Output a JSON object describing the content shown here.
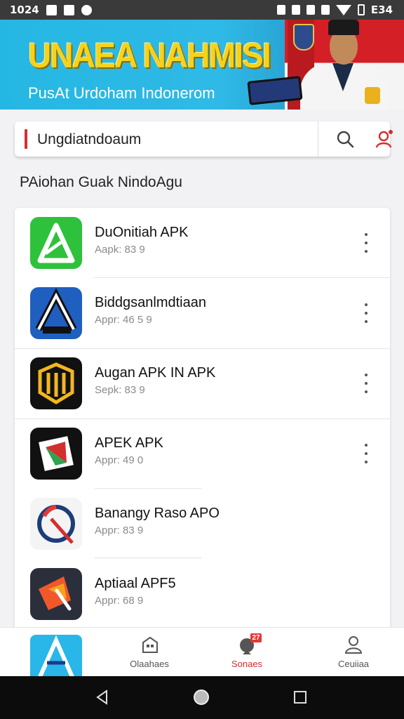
{
  "status_bar": {
    "time": "1024",
    "battery": "E34"
  },
  "banner": {
    "title": "UNAEA NAHMISI",
    "subtitle": "PusAt Urdoham Indonerom"
  },
  "search": {
    "value": "Ungdiatndoaum",
    "placeholder": ""
  },
  "section_title": "PAiohan Guak NindoAgu",
  "apps": [
    {
      "name": "DuOnitiah APK",
      "size": "Aapk: 83 9"
    },
    {
      "name": "Biddgsanlmdtiaan",
      "size": "Appr: 46 5 9"
    },
    {
      "name": "Augan APK IN APK",
      "size": "Sepk: 83 9"
    },
    {
      "name": "APEK APK",
      "size": "Appr: 49 0"
    },
    {
      "name": "Banangy Raso APO",
      "size": "Appr: 83 9"
    },
    {
      "name": "Aptiaal APF5",
      "size": "Appr: 68 9"
    }
  ],
  "bottom_nav": {
    "items": [
      {
        "label": "",
        "icon": "app-logo-icon"
      },
      {
        "label": "Olaahaes",
        "icon": "store-icon"
      },
      {
        "label": "Sonaes",
        "icon": "notifications-icon",
        "active": true
      },
      {
        "label": "Ceuiiaa",
        "icon": "person-icon"
      }
    ],
    "badge": "27"
  },
  "colors": {
    "accent": "#d32f2f",
    "banner_bg": "#29b6e9",
    "banner_title": "#f6d21a"
  }
}
